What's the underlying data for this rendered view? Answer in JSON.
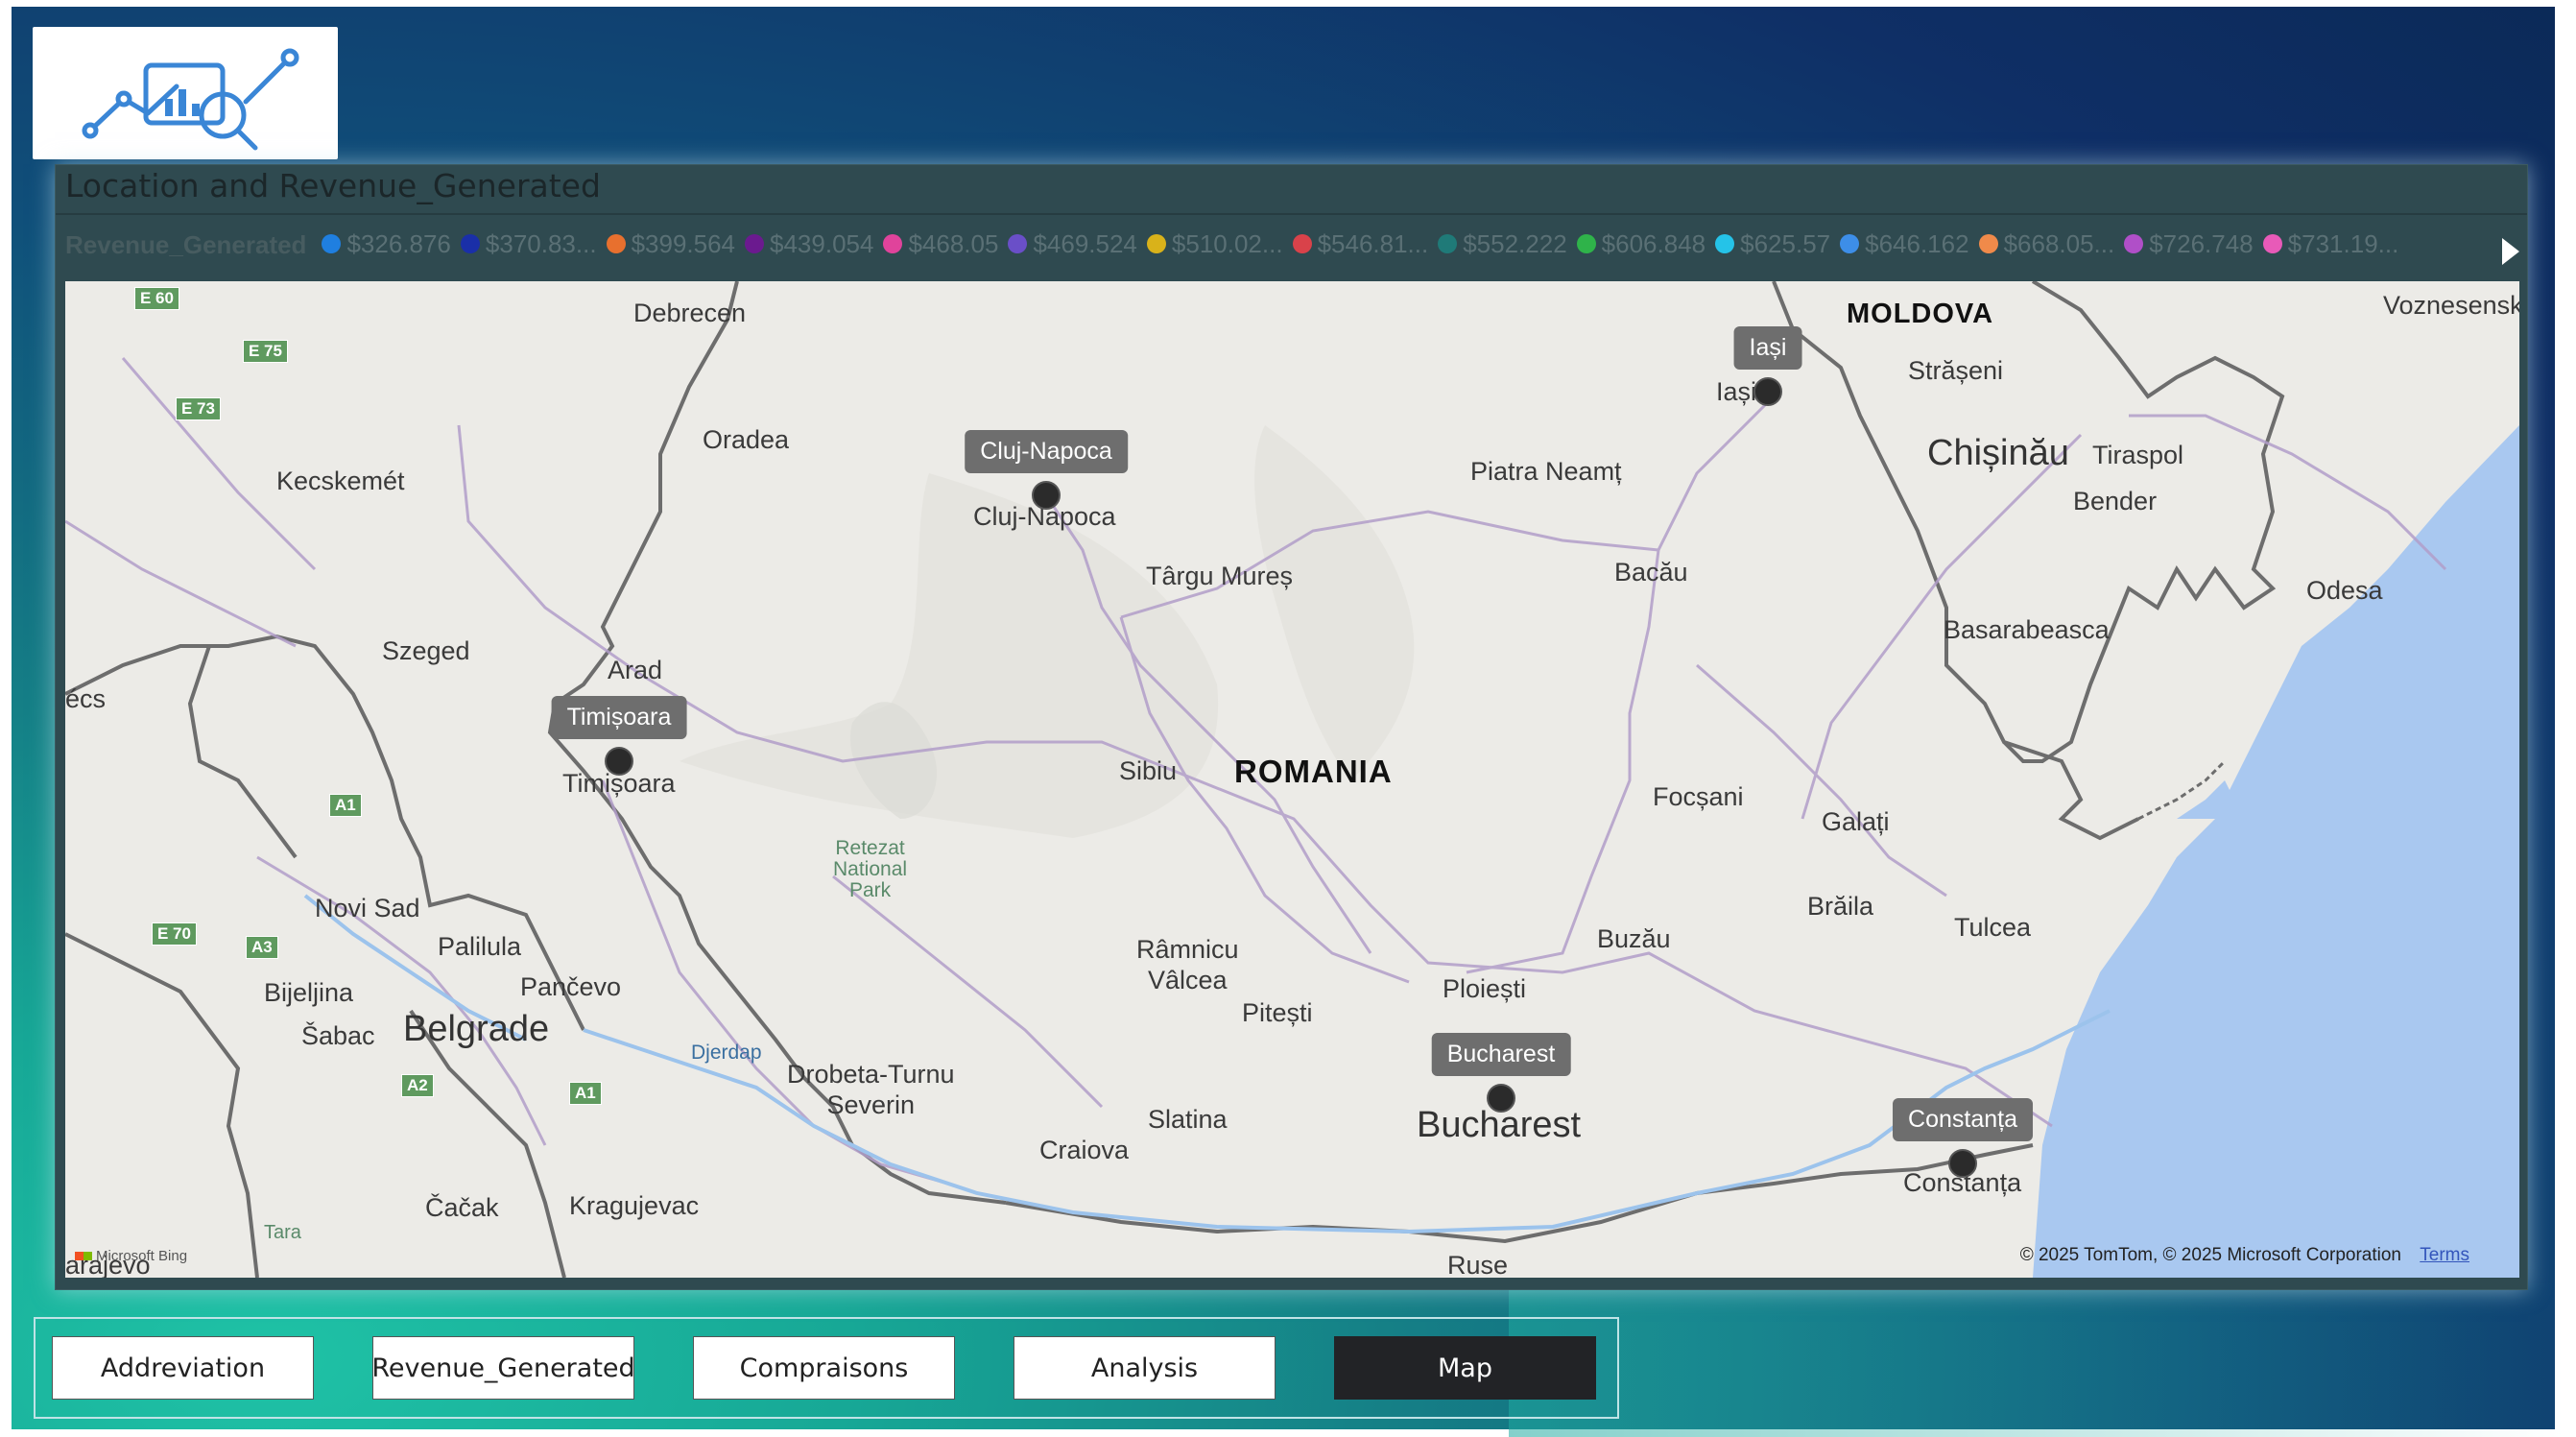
{
  "visual": {
    "title": "Location and Revenue_Generated",
    "legend_title": "Revenue_Generated",
    "legend_items": [
      {
        "label": "$326.876",
        "color": "#1f7fe0"
      },
      {
        "label": "$370.83...",
        "color": "#1a2fa8"
      },
      {
        "label": "$399.564",
        "color": "#e8702e"
      },
      {
        "label": "$439.054",
        "color": "#6b1a8f"
      },
      {
        "label": "$468.05",
        "color": "#e0439b"
      },
      {
        "label": "$469.524",
        "color": "#6a4fc8"
      },
      {
        "label": "$510.02...",
        "color": "#d9b21a"
      },
      {
        "label": "$546.81...",
        "color": "#d9424a"
      },
      {
        "label": "$552.222",
        "color": "#1f7a78"
      },
      {
        "label": "$606.848",
        "color": "#2fb34a"
      },
      {
        "label": "$625.57",
        "color": "#25c3e8"
      },
      {
        "label": "$646.162",
        "color": "#3d8ee8"
      },
      {
        "label": "$668.05...",
        "color": "#f08a4a"
      },
      {
        "label": "$726.748",
        "color": "#b04fc8"
      },
      {
        "label": "$731.19...",
        "color": "#e85ab8"
      }
    ]
  },
  "map": {
    "markers": [
      {
        "name": "Cluj-Napoca"
      },
      {
        "name": "Iași"
      },
      {
        "name": "Timișoara"
      },
      {
        "name": "Bucharest"
      },
      {
        "name": "Constanța"
      }
    ],
    "labels": {
      "romania": "ROMANIA",
      "moldova": "MOLDOVA",
      "debrecen": "Debrecen",
      "oradea": "Oradea",
      "kecskemet": "Kecskemét",
      "szeged": "Szeged",
      "arad": "Arad",
      "pecs": "écs",
      "timisoara": "Timișoara",
      "cluj": "Cluj-Napoca",
      "targu_mures": "Târgu Mureș",
      "sibiu": "Sibiu",
      "retezat": "Retezat\nNational\nPark",
      "piatra": "Piatra Neamț",
      "bacau": "Bacău",
      "iasi": "Iași",
      "straseni": "Strășeni",
      "chisinau": "Chișinău",
      "tiraspol": "Tiraspol",
      "bender": "Bender",
      "voznesensk": "Voznesensk",
      "odesa": "Odesa",
      "basarabeasca": "Basarabeasca",
      "focsani": "Focșani",
      "galati": "Galați",
      "braila": "Brăila",
      "tulcea": "Tulcea",
      "buzau": "Buzău",
      "ploiesti": "Ploiești",
      "bucharest": "Bucharest",
      "constanta": "Constanța",
      "pitesti": "Pitești",
      "ramnicu": "Râmnicu\nVâlcea",
      "slatina": "Slatina",
      "craiova": "Craiova",
      "drobeta": "Drobeta-Turnu\nSeverin",
      "djerdap": "Djerdap",
      "ruse": "Ruse",
      "novi_sad": "Novi Sad",
      "palilula": "Palilula",
      "pancevo": "Pančevo",
      "bijeljina": "Bijeljina",
      "sabac": "Šabac",
      "belgrade": "Belgrade",
      "cacak": "Čačak",
      "kragujevac": "Kragujevac",
      "tara": "Tara",
      "sarajevo": "arajevo"
    },
    "road_shields": [
      "E 60",
      "E 75",
      "E 73",
      "A1",
      "E 70",
      "A3",
      "A2",
      "A1"
    ],
    "attribution": "© 2025 TomTom, © 2025 Microsoft Corporation",
    "terms": "Terms",
    "provider": "Microsoft Bing"
  },
  "nav": {
    "buttons": [
      "Addreviation",
      "Revenue_Generated",
      "Compraisons",
      "Analysis",
      "Map"
    ],
    "active": "Map"
  }
}
